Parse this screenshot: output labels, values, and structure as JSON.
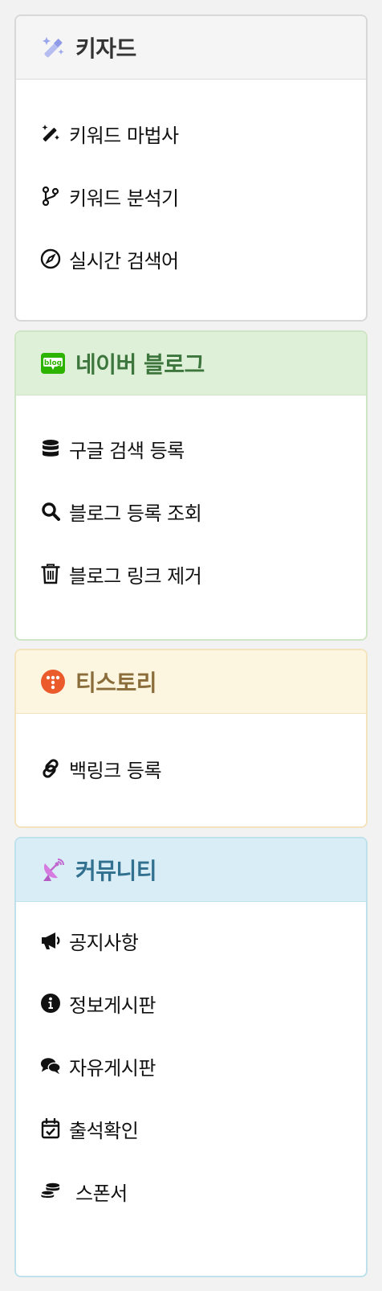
{
  "keyzard": {
    "title": "키자드",
    "items": [
      {
        "label": "키워드 마법사",
        "icon": "magic-wand-icon"
      },
      {
        "label": "키워드 분석기",
        "icon": "code-branch-icon"
      },
      {
        "label": "실시간 검색어",
        "icon": "compass-icon"
      }
    ]
  },
  "naver_blog": {
    "title": "네이버 블로그",
    "items": [
      {
        "label": "구글 검색 등록",
        "icon": "database-icon"
      },
      {
        "label": "블로그 등록 조회",
        "icon": "search-icon"
      },
      {
        "label": "블로그 링크 제거",
        "icon": "trash-icon"
      }
    ]
  },
  "tistory": {
    "title": "티스토리",
    "items": [
      {
        "label": "백링크 등록",
        "icon": "link-icon"
      }
    ]
  },
  "community": {
    "title": "커뮤니티",
    "items": [
      {
        "label": "공지사항",
        "icon": "megaphone-icon"
      },
      {
        "label": "정보게시판",
        "icon": "info-circle-icon"
      },
      {
        "label": "자유게시판",
        "icon": "comments-icon"
      },
      {
        "label": "출석확인",
        "icon": "calendar-check-icon"
      },
      {
        "label": "스폰서",
        "icon": "coins-icon"
      }
    ]
  },
  "colors": {
    "naver_green": "#3c763d",
    "tistory_brown": "#8a6d3b",
    "community_blue": "#31708f",
    "tistory_orange": "#ea5a2b"
  }
}
